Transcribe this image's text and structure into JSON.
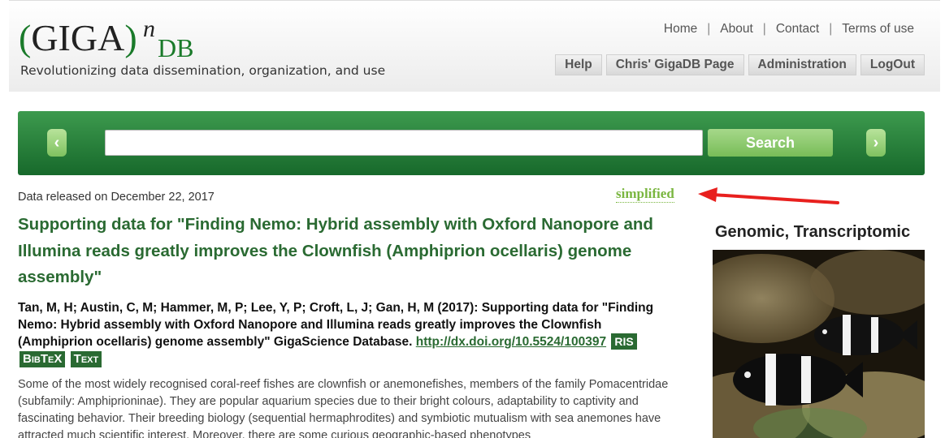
{
  "header": {
    "logo_paren_open": "(",
    "logo_giga": "GIGA",
    "logo_paren_close": ")",
    "logo_sup": "n",
    "logo_db": "DB",
    "tagline": "Revolutionizing data dissemination, organization, and use",
    "links": [
      "Home",
      "About",
      "Contact",
      "Terms of use"
    ],
    "user_buttons": [
      "Help",
      "Chris' GigaDB Page",
      "Administration",
      "LogOut"
    ]
  },
  "search": {
    "value": "",
    "placeholder": "",
    "button_label": "Search",
    "prev_label": "‹",
    "next_label": "›"
  },
  "dataset": {
    "released": "Data released on December 22, 2017",
    "simplified_label": "simplified",
    "title": "Supporting data for \"Finding Nemo: Hybrid assembly with Oxford Nanopore and Illumina reads greatly improves the Clownfish (Amphiprion ocellaris) genome assembly\"",
    "citation": "Tan, M, H; Austin, C, M; Hammer, M, P; Lee, Y, P; Croft, L, J; Gan, H, M (2017): Supporting data for \"Finding Nemo: Hybrid assembly with Oxford Nanopore and Illumina reads greatly improves the Clownfish (Amphiprion ocellaris) genome assembly\" GigaScience Database.",
    "doi": "http://dx.doi.org/10.5524/100397",
    "formats": [
      "RIS",
      "BibTeX",
      "Text"
    ],
    "abstract": "Some of the most widely recognised coral-reef fishes are clownfish or anemonefishes, members of the family Pomacentridae (subfamily: Amphiprioninae). They are popular aquarium species due to their bright colours, adaptability to captivity and fascinating behavior. Their breeding biology (sequential hermaphrodites) and symbiotic mutualism with sea anemones have attracted much scientific interest. Moreover, there are some curious geographic-based phenotypes"
  },
  "sidebar": {
    "type_title": "Genomic, Transcriptomic"
  },
  "colors": {
    "brand_green": "#2a6a32",
    "search_bar": "#1f7a33",
    "accent_light_green": "#7ab640",
    "annotation_arrow": "#e8201e"
  }
}
